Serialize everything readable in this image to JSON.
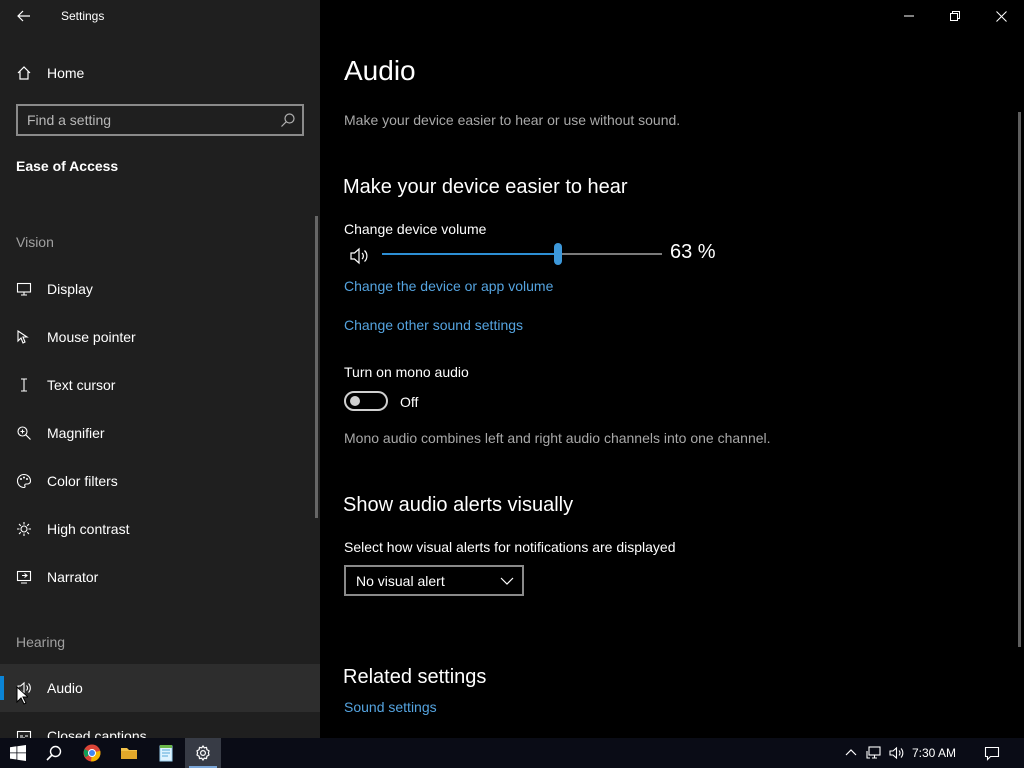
{
  "window": {
    "title": "Settings"
  },
  "sidebar": {
    "home_label": "Home",
    "search": {
      "placeholder": "Find a setting"
    },
    "category_title": "Ease of Access",
    "groups": {
      "vision": {
        "header": "Vision",
        "items": [
          {
            "label": "Display",
            "icon": "monitor-icon"
          },
          {
            "label": "Mouse pointer",
            "icon": "mouse-pointer-icon"
          },
          {
            "label": "Text cursor",
            "icon": "text-cursor-icon"
          },
          {
            "label": "Magnifier",
            "icon": "magnifier-icon"
          },
          {
            "label": "Color filters",
            "icon": "palette-icon"
          },
          {
            "label": "High contrast",
            "icon": "contrast-icon"
          },
          {
            "label": "Narrator",
            "icon": "narrator-icon"
          }
        ]
      },
      "hearing": {
        "header": "Hearing",
        "items": [
          {
            "label": "Audio",
            "icon": "speaker-icon",
            "selected": true
          },
          {
            "label": "Closed captions",
            "icon": "captions-icon"
          }
        ]
      }
    }
  },
  "main": {
    "title": "Audio",
    "description": "Make your device easier to hear or use without sound.",
    "hear_section": {
      "heading": "Make your device easier to hear",
      "volume_label": "Change device volume",
      "volume_value": 63,
      "volume_text": "63 %",
      "link_device_volume": "Change the device or app volume",
      "link_sound_settings": "Change other sound settings",
      "mono_label": "Turn on mono audio",
      "mono_state": "Off",
      "mono_desc": "Mono audio combines left and right audio channels into one channel."
    },
    "alerts_section": {
      "heading": "Show audio alerts visually",
      "select_label": "Select how visual alerts for notifications are displayed",
      "select_value": "No visual alert"
    },
    "related": {
      "heading": "Related settings",
      "link": "Sound settings"
    }
  },
  "taskbar": {
    "apps": [
      "start-icon",
      "search-icon",
      "chrome-icon",
      "file-explorer-icon",
      "notepad-icon",
      "settings-icon"
    ],
    "clock": "7:30 AM"
  },
  "colors": {
    "accent": "#0a84d6",
    "link": "#55a4e0",
    "sidebar_bg": "#1f1f1f"
  }
}
